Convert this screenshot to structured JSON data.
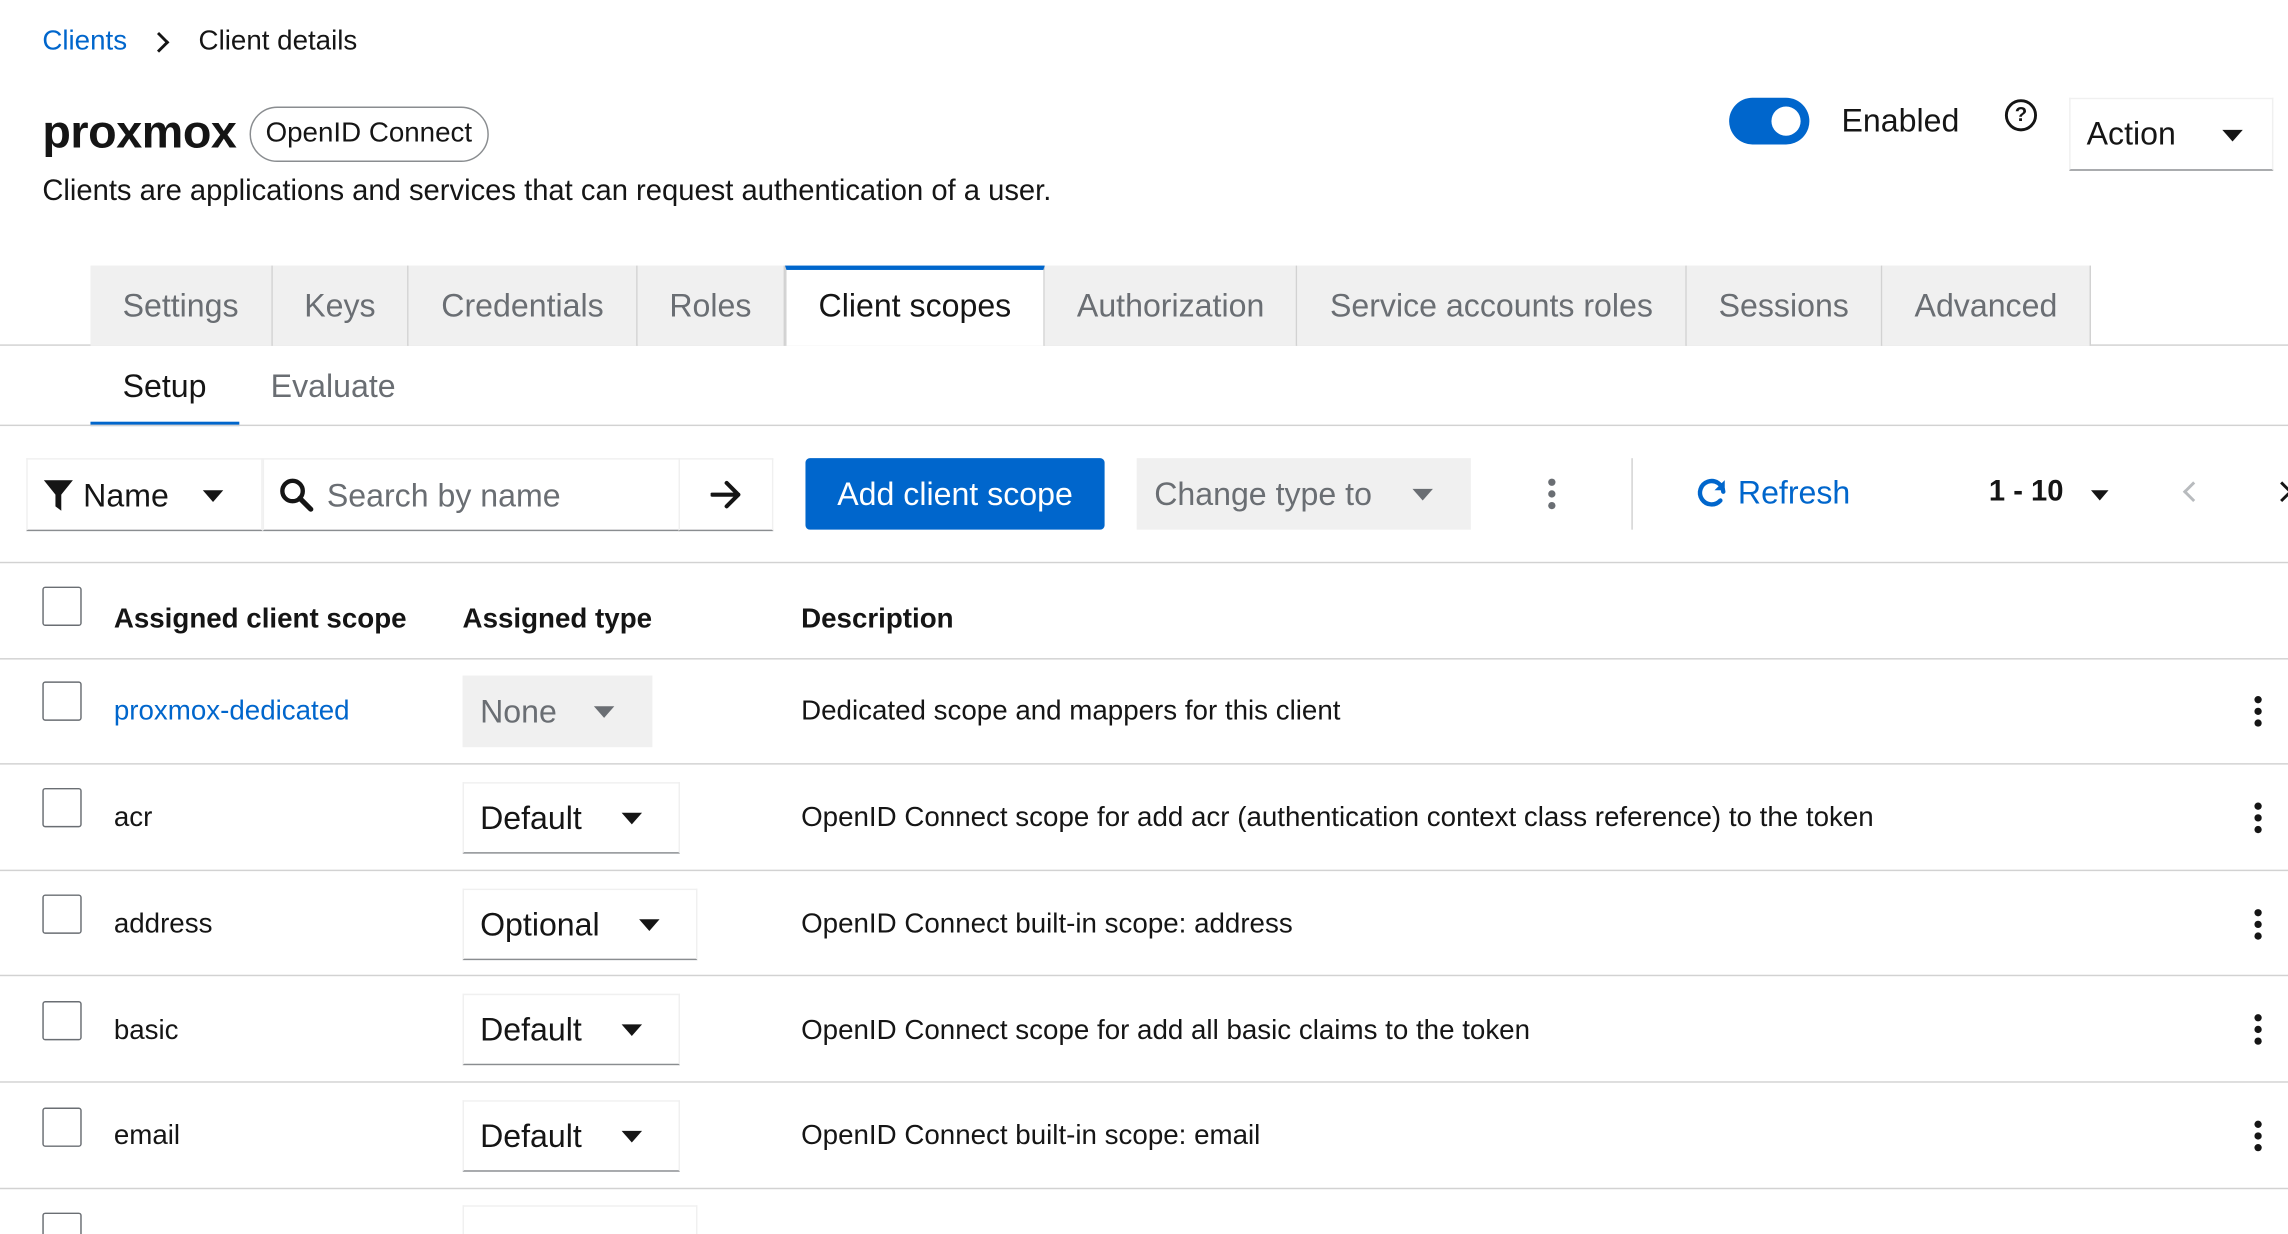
{
  "breadcrumb": {
    "parent": "Clients",
    "current": "Client details"
  },
  "header": {
    "title": "proxmox",
    "protocol_badge": "OpenID Connect",
    "subtitle": "Clients are applications and services that can request authentication of a user.",
    "enabled_label": "Enabled",
    "enabled": true,
    "action_label": "Action"
  },
  "tabs": [
    {
      "label": "Settings"
    },
    {
      "label": "Keys"
    },
    {
      "label": "Credentials"
    },
    {
      "label": "Roles"
    },
    {
      "label": "Client scopes",
      "active": true
    },
    {
      "label": "Authorization"
    },
    {
      "label": "Service accounts roles"
    },
    {
      "label": "Sessions"
    },
    {
      "label": "Advanced"
    }
  ],
  "subtabs": [
    {
      "label": "Setup",
      "active": true
    },
    {
      "label": "Evaluate"
    }
  ],
  "toolbar": {
    "filter_label": "Name",
    "search_placeholder": "Search by name",
    "add_label": "Add client scope",
    "change_type_label": "Change type to",
    "refresh_label": "Refresh",
    "pagination_label": "1 - 10"
  },
  "table": {
    "headers": {
      "name": "Assigned client scope",
      "type": "Assigned type",
      "description": "Description"
    },
    "rows": [
      {
        "name": "proxmox-dedicated",
        "type": "None",
        "description": "Dedicated scope and mappers for this client"
      },
      {
        "name": "acr",
        "type": "Default",
        "description": "OpenID Connect scope for add acr (authentication context class reference) to the token"
      },
      {
        "name": "address",
        "type": "Optional",
        "description": "OpenID Connect built-in scope: address"
      },
      {
        "name": "basic",
        "type": "Default",
        "description": "OpenID Connect scope for add all basic claims to the token"
      },
      {
        "name": "email",
        "type": "Default",
        "description": "OpenID Connect built-in scope: email"
      }
    ]
  },
  "colors": {
    "primary": "#0066cc",
    "border": "#d2d2d2",
    "muted": "#6a6e73"
  }
}
